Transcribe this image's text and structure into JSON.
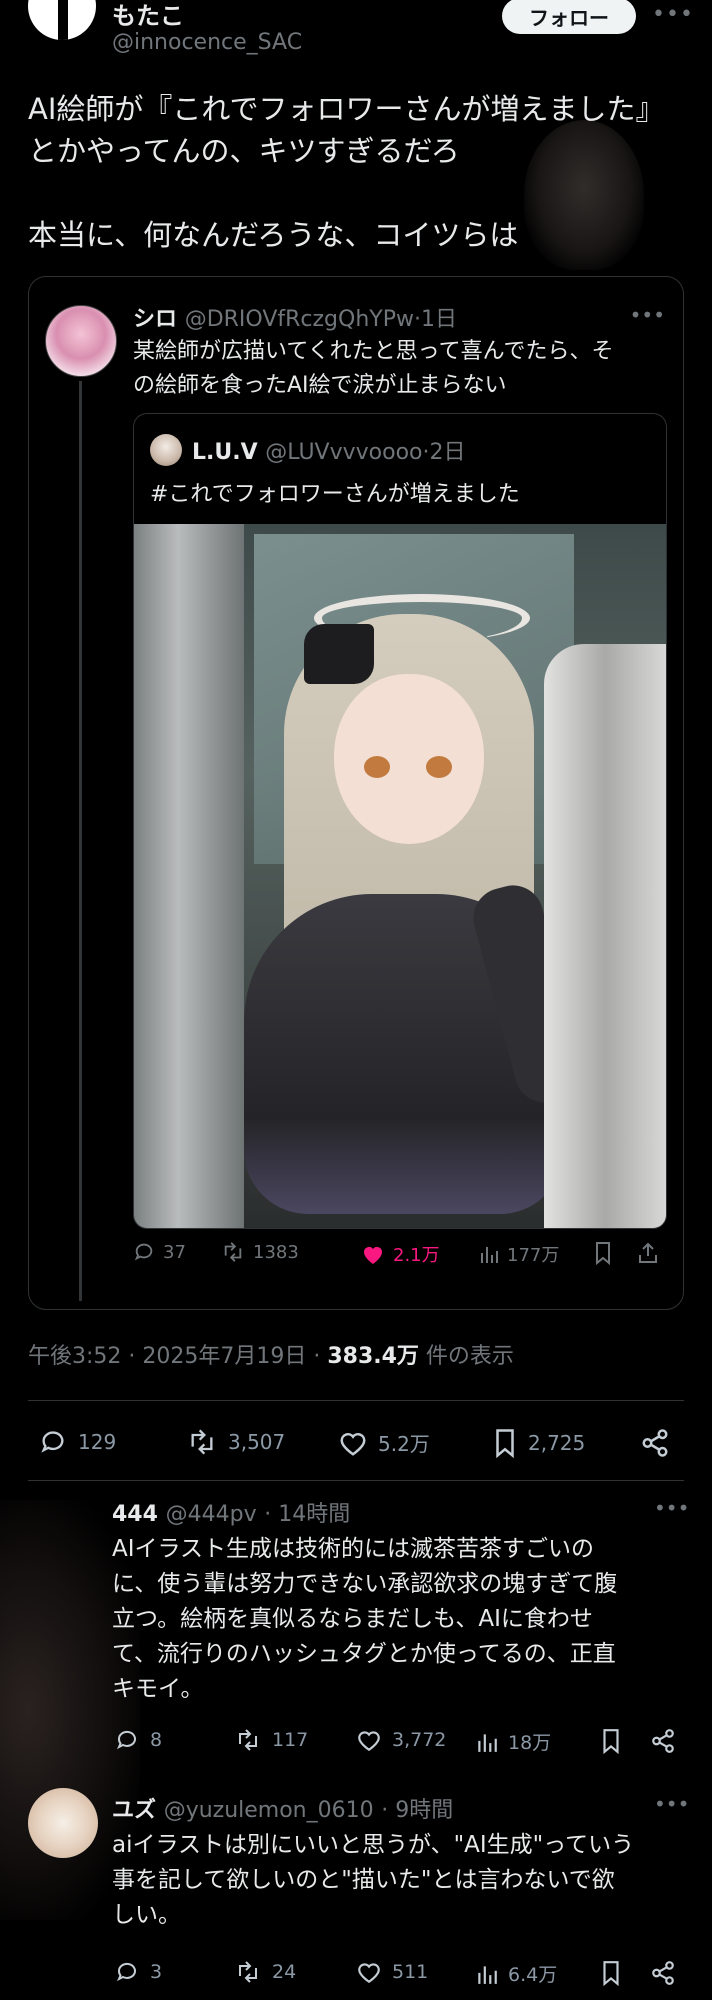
{
  "author": {
    "name": "もたこ",
    "handle": "@innocence_SAC",
    "follow_label": "フォロー",
    "more": "•••"
  },
  "post": {
    "line1": "AI絵師が『これでフォロワーさんが増えました』",
    "line2": "とかやってんの、キツすぎるだろ",
    "line3": "本当に、何なんだろうな、コイツらは"
  },
  "quote": {
    "name": "シロ",
    "handle": "@DRIOVfRczgQhYPw",
    "time": "·1日",
    "text_line1": "某絵師が広描いてくれたと思って喜んでたら、そ",
    "text_line2": "の絵師を食ったAI絵で涙が止まらない",
    "inner": {
      "name": "L.U.V",
      "handle": "@LUVvvvoooo",
      "time": "·2日",
      "text": "#これでフォロワーさんが増えました"
    },
    "stats": {
      "replies": "37",
      "reposts": "1383",
      "likes": "2.1万",
      "views": "177万"
    }
  },
  "meta": {
    "time": "午後3:52 · 2025年7月19日 · ",
    "views": "383.4万",
    "views_suffix": " 件の表示"
  },
  "actions": {
    "replies": "129",
    "reposts": "3,507",
    "likes": "5.2万",
    "bookmarks": "2,725"
  },
  "replies": [
    {
      "name": "444",
      "handle": "@444pv",
      "time": "· 14時間",
      "lines": [
        "AIイラスト生成は技術的には滅茶苦茶すごいの",
        "に、使う輩は努力できない承認欲求の塊すぎて腹",
        "立つ。絵柄を真似るならまだしも、AIに食わせ",
        "て、流行りのハッシュタグとか使ってるの、正直",
        "キモイ。"
      ],
      "stats": {
        "replies": "8",
        "reposts": "117",
        "likes": "3,772",
        "views": "18万"
      }
    },
    {
      "name": "ユズ",
      "handle": "@yuzulemon_0610",
      "time": "· 9時間",
      "lines": [
        "aiイラストは別にいいと思うが、\"AI生成\"っていう",
        "事を記して欲しいのと\"描いた\"とは言わないで欲",
        "しい。"
      ],
      "stats": {
        "replies": "3",
        "reposts": "24",
        "likes": "511",
        "views": "6.4万"
      }
    }
  ]
}
